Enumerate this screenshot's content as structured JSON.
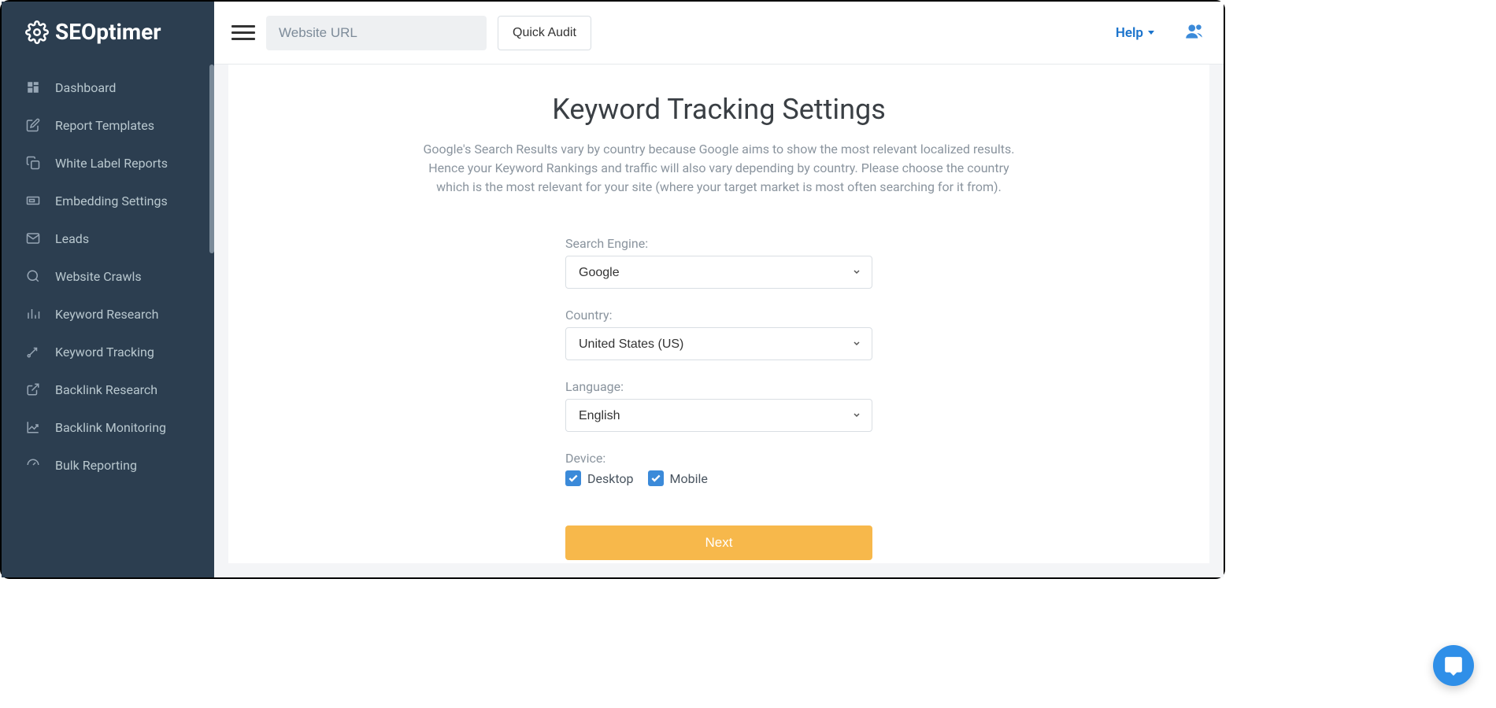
{
  "brand": "SEOptimer",
  "sidebar": {
    "items": [
      {
        "label": "Dashboard",
        "icon": "dashboard"
      },
      {
        "label": "Report Templates",
        "icon": "edit"
      },
      {
        "label": "White Label Reports",
        "icon": "copy"
      },
      {
        "label": "Embedding Settings",
        "icon": "embed"
      },
      {
        "label": "Leads",
        "icon": "mail"
      },
      {
        "label": "Website Crawls",
        "icon": "search"
      },
      {
        "label": "Keyword Research",
        "icon": "barchart"
      },
      {
        "label": "Keyword Tracking",
        "icon": "arrow"
      },
      {
        "label": "Backlink Research",
        "icon": "external"
      },
      {
        "label": "Backlink Monitoring",
        "icon": "linechart"
      },
      {
        "label": "Bulk Reporting",
        "icon": "gauge"
      }
    ]
  },
  "topbar": {
    "url_placeholder": "Website URL",
    "audit_button": "Quick Audit",
    "help": "Help"
  },
  "page": {
    "title": "Keyword Tracking Settings",
    "description": "Google's Search Results vary by country because Google aims to show the most relevant localized results. Hence your Keyword Rankings and traffic will also vary depending by country. Please choose the country which is the most relevant for your site (where your target market is most often searching for it from).",
    "form": {
      "search_engine_label": "Search Engine:",
      "search_engine_value": "Google",
      "country_label": "Country:",
      "country_value": "United States (US)",
      "language_label": "Language:",
      "language_value": "English",
      "device_label": "Device:",
      "device_desktop": "Desktop",
      "device_mobile": "Mobile",
      "next_button": "Next"
    }
  }
}
